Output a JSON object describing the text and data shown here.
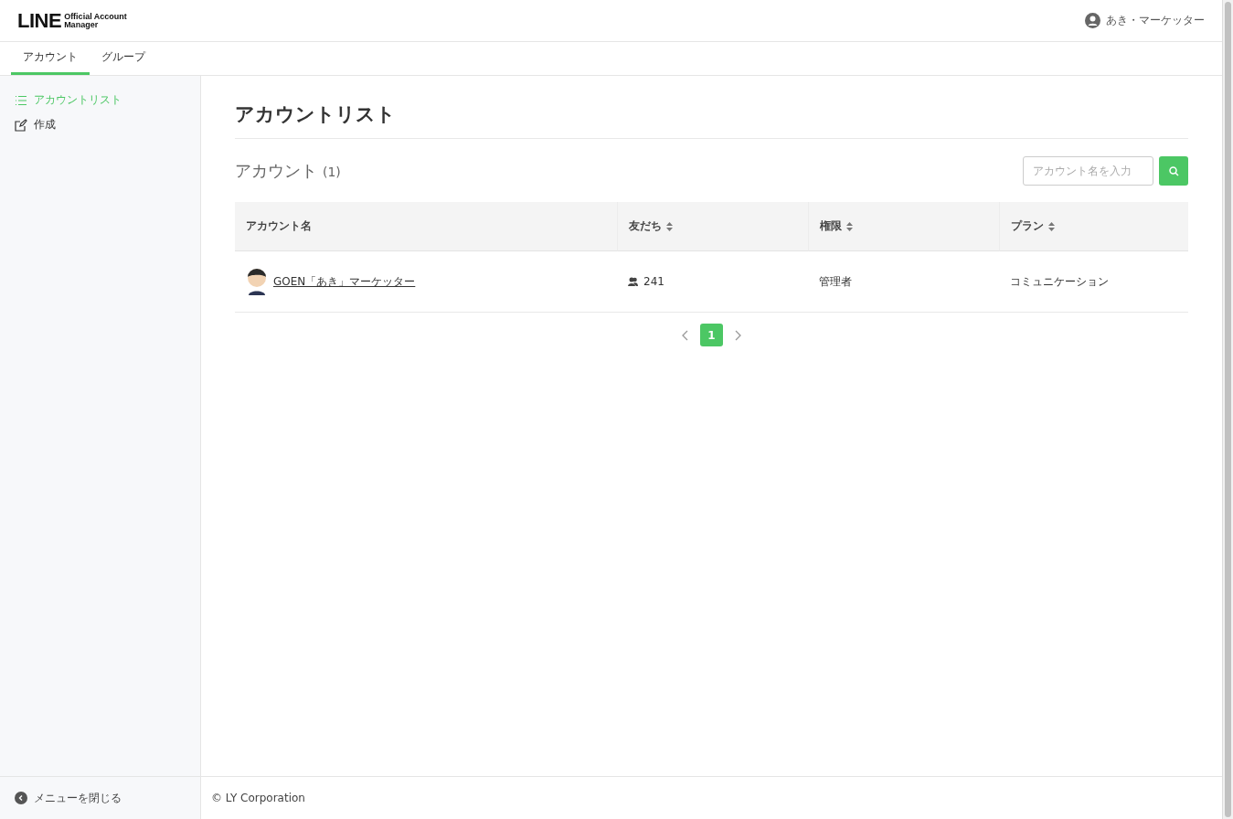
{
  "header": {
    "logo": {
      "wordmark": "LINE",
      "line_1": "Official Account",
      "line_2": "Manager"
    },
    "user": "あき・マーケッター"
  },
  "tabs": [
    {
      "label": "アカウント",
      "selected": true
    },
    {
      "label": "グループ",
      "selected": false
    }
  ],
  "sidebar": {
    "items": [
      {
        "label": "アカウントリスト",
        "kind": "list",
        "selected": true
      },
      {
        "label": "作成",
        "kind": "edit",
        "selected": false
      }
    ],
    "close_menu": "メニューを閉じる"
  },
  "page": {
    "title": "アカウントリスト",
    "section": "アカウント",
    "count": "(1)",
    "search": {
      "placeholder": "アカウント名を入力"
    }
  },
  "table": {
    "columns": [
      {
        "label": "アカウント名",
        "sortable": false
      },
      {
        "label": "友だち",
        "sortable": true
      },
      {
        "label": "権限",
        "sortable": true
      },
      {
        "label": "プラン",
        "sortable": true
      }
    ],
    "rows": [
      {
        "name": "GOEN「あき」マーケッター",
        "friends": "241",
        "role": "管理者",
        "plan": "コミュニケーション"
      }
    ]
  },
  "pagination": {
    "pages": [
      {
        "label": "1",
        "selected": true
      }
    ]
  },
  "footer": "© LY Corporation"
}
